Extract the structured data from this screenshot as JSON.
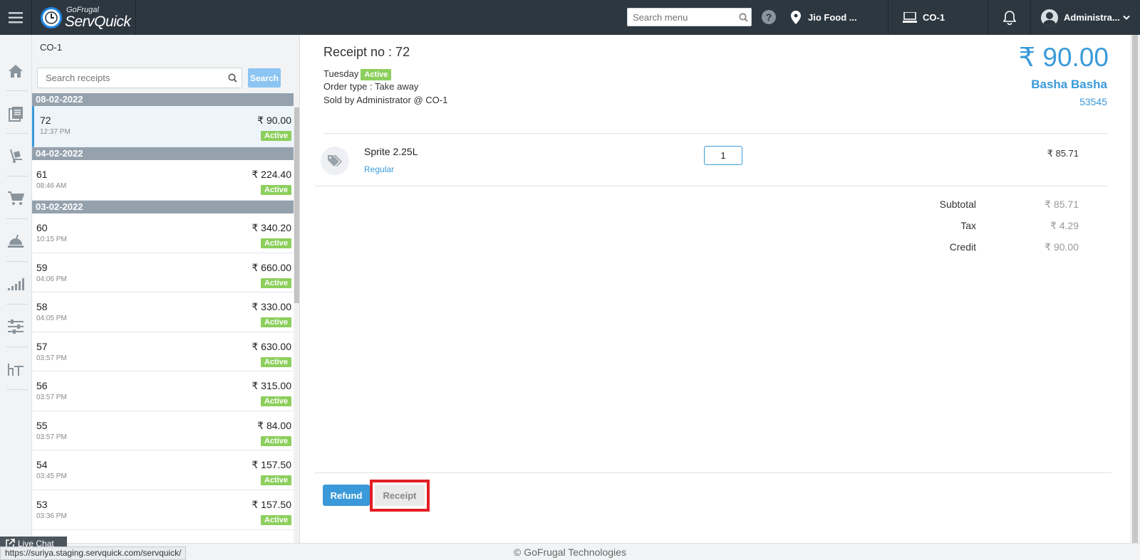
{
  "header": {
    "logo_small": "GoFrugal",
    "logo_big": "ServQuick",
    "search_placeholder": "Search menu",
    "help": "?",
    "location": "Jio Food ...",
    "counter": "CO-1",
    "user": "Administra..."
  },
  "list": {
    "title": "CO-1",
    "search_placeholder": "Search receipts",
    "search_button": "Search",
    "groups": [
      {
        "date": "08-02-2022",
        "rows": [
          {
            "no": "72",
            "time": "12:37 PM",
            "amount": "₹ 90.00",
            "status": "Active"
          }
        ]
      },
      {
        "date": "04-02-2022",
        "rows": [
          {
            "no": "61",
            "time": "08:46 AM",
            "amount": "₹ 224.40",
            "status": "Active"
          }
        ]
      },
      {
        "date": "03-02-2022",
        "rows": [
          {
            "no": "60",
            "time": "10:15 PM",
            "amount": "₹ 340.20",
            "status": "Active"
          },
          {
            "no": "59",
            "time": "04:06 PM",
            "amount": "₹ 660.00",
            "status": "Active"
          },
          {
            "no": "58",
            "time": "04:05 PM",
            "amount": "₹ 330.00",
            "status": "Active"
          },
          {
            "no": "57",
            "time": "03:57 PM",
            "amount": "₹ 630.00",
            "status": "Active"
          },
          {
            "no": "56",
            "time": "03:57 PM",
            "amount": "₹ 315.00",
            "status": "Active"
          },
          {
            "no": "55",
            "time": "03:57 PM",
            "amount": "₹ 84.00",
            "status": "Active"
          },
          {
            "no": "54",
            "time": "03:45 PM",
            "amount": "₹ 157.50",
            "status": "Active"
          },
          {
            "no": "53",
            "time": "03:36 PM",
            "amount": "₹ 157.50",
            "status": "Active"
          }
        ]
      }
    ]
  },
  "receipt": {
    "title": "Receipt no : 72",
    "day": "Tuesday",
    "status": "Active",
    "order_type": "Order type : Take away",
    "sold_by": "Sold by Administrator @ CO-1",
    "total": "₹ 90.00",
    "customer_name": "Basha Basha",
    "customer_id": "53545",
    "item": {
      "name": "Sprite 2.25L",
      "variant": "Regular",
      "qty": "1",
      "price": "₹ 85.71"
    },
    "summary": [
      {
        "label": "Subtotal",
        "value": "₹ 85.71"
      },
      {
        "label": "Tax",
        "value": "₹ 4.29"
      },
      {
        "label": "Credit",
        "value": "₹ 90.00"
      }
    ],
    "refund_button": "Refund",
    "receipt_button": "Receipt"
  },
  "footer": {
    "copyright": "© GoFrugal Technologies",
    "live_chat": "Live Chat",
    "status_url": "https://suriya.staging.servquick.com/servquick/"
  }
}
